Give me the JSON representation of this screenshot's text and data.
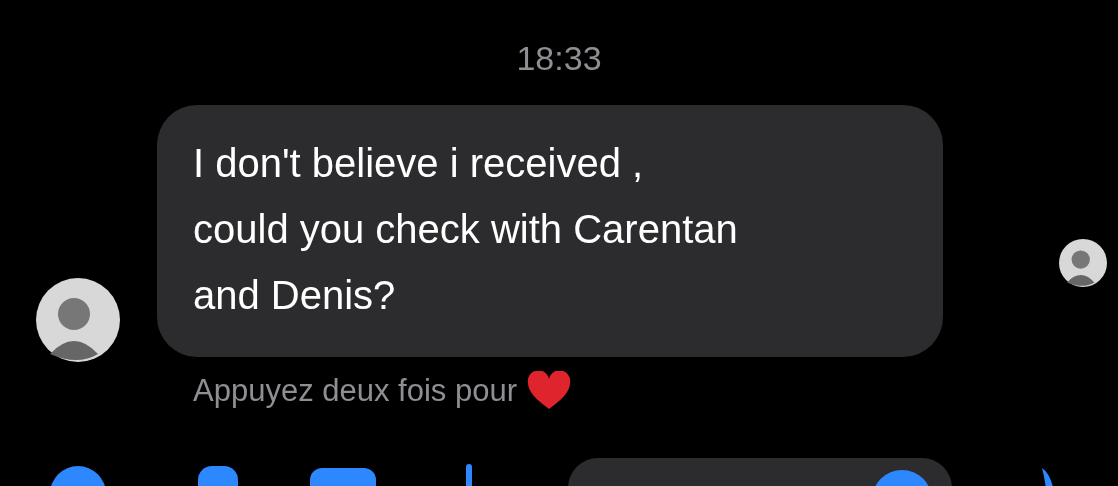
{
  "timestamp": "18:33",
  "messages": [
    {
      "text": "I don't believe i received ,\ncould you check with Carentan\nand Denis?",
      "hint": "Appuyez deux fois pour",
      "seen": true
    }
  ],
  "composer": {
    "kind": "partial"
  }
}
